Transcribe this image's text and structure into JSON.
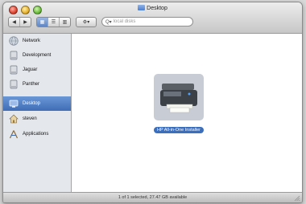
{
  "window": {
    "title": "Desktop"
  },
  "toolbar": {
    "back_icon": "back-arrow-icon",
    "forward_icon": "forward-arrow-icon",
    "view_modes": [
      "icon-view",
      "list-view",
      "column-view"
    ],
    "active_view": "icon-view",
    "action_icon": "gear-icon",
    "search": {
      "placeholder": "local disks"
    }
  },
  "sidebar": {
    "items": [
      {
        "label": "Network",
        "icon": "globe-icon",
        "selected": false
      },
      {
        "label": "Development",
        "icon": "hard-disk-icon",
        "selected": false
      },
      {
        "label": "Jaguar",
        "icon": "hard-disk-icon",
        "selected": false
      },
      {
        "label": "Panther",
        "icon": "hard-disk-icon",
        "selected": false
      },
      {
        "label": "Desktop",
        "icon": "desktop-icon",
        "selected": true
      },
      {
        "label": "steven",
        "icon": "home-icon",
        "selected": false
      },
      {
        "label": "Applications",
        "icon": "applications-icon",
        "selected": false
      }
    ]
  },
  "main": {
    "items": [
      {
        "label": "HP All-in-One Installer",
        "icon": "printer-icon",
        "selected": true
      }
    ]
  },
  "status": {
    "text": "1 of 1 selected, 27.47 GB available"
  },
  "colors": {
    "selection": "#3f6db6",
    "sidebar_bg": "#e4e7ec"
  }
}
